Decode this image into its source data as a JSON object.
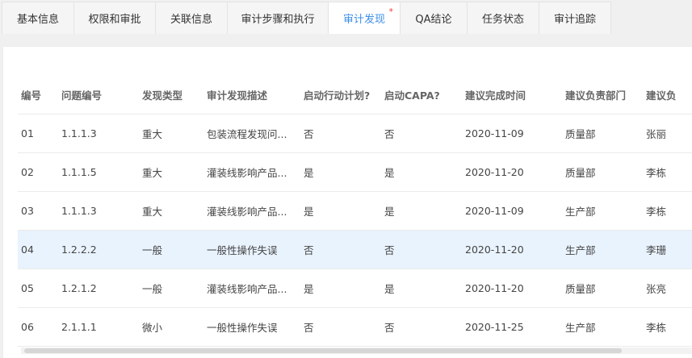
{
  "tabs": [
    {
      "label": "基本信息"
    },
    {
      "label": "权限和审批"
    },
    {
      "label": "关联信息"
    },
    {
      "label": "审计步骤和执行"
    },
    {
      "label": "审计发现",
      "required_mark": "*"
    },
    {
      "label": "QA结论"
    },
    {
      "label": "任务状态"
    },
    {
      "label": "审计追踪"
    }
  ],
  "active_tab": "审计发现",
  "colors": {
    "accent": "#3e8fe8",
    "required": "#e8443a",
    "selected_row": "#e9f3fe"
  },
  "table": {
    "columns": [
      "编号",
      "问题编号",
      "发现类型",
      "审计发现描述",
      "启动行动计划?",
      "启动CAPA?",
      "建议完成时间",
      "建议负责部门",
      "建议负"
    ],
    "rows": [
      [
        "01",
        "1.1.1.3",
        "重大",
        "包装流程发现问...",
        "否",
        "否",
        "2020-11-09",
        "质量部",
        "张丽"
      ],
      [
        "02",
        "1.1.1.5",
        "重大",
        "灌装线影响产品...",
        "是",
        "是",
        "2020-11-20",
        "质量部",
        "李栋"
      ],
      [
        "03",
        "1.1.1.3",
        "重大",
        "灌装线影响产品...",
        "是",
        "是",
        "2020-11-09",
        "生产部",
        "李栋"
      ],
      [
        "04",
        "1.2.2.2",
        "一般",
        "一般性操作失误",
        "否",
        "否",
        "2020-11-20",
        "生产部",
        "李珊"
      ],
      [
        "05",
        "1.2.1.2",
        "一般",
        "灌装线影响产品...",
        "是",
        "是",
        "2020-11-20",
        "质量部",
        "张亮"
      ],
      [
        "06",
        "2.1.1.1",
        "微小",
        "一般性操作失误",
        "否",
        "否",
        "2020-11-25",
        "生产部",
        "李栋"
      ]
    ],
    "selected_row_index": 3
  }
}
